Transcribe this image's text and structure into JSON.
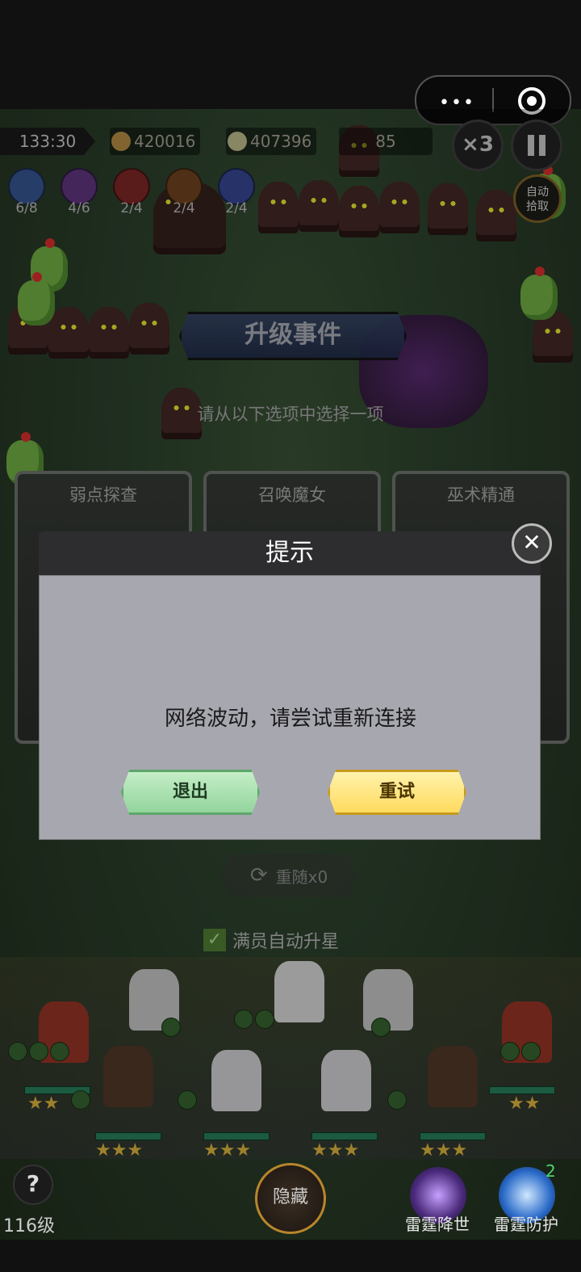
{
  "hud": {
    "timer": "133:30",
    "gold": "420016",
    "skulls": "407396",
    "kills": "85",
    "speed": "×3",
    "auto_pickup": "自动\n拾取"
  },
  "skills": [
    {
      "count": "6/8",
      "color": "#3b5ea0"
    },
    {
      "count": "4/6",
      "color": "#6a3b8a"
    },
    {
      "count": "2/4",
      "color": "#8a2a2a"
    },
    {
      "count": "2/4",
      "color": "#7a4a22"
    },
    {
      "count": "2/4",
      "color": "#3b4ea0"
    }
  ],
  "event": {
    "title": "升级事件",
    "subtitle": "请从以下选项中选择一项",
    "cards": [
      "弱点探查",
      "召唤魔女",
      "巫术精通"
    ]
  },
  "dialog": {
    "title": "提示",
    "message": "网络波动，请尝试重新连接",
    "exit_label": "退出",
    "retry_label": "重试",
    "close_glyph": "✕"
  },
  "refresh": {
    "label": "重随x0"
  },
  "auto_star": {
    "label": "满员自动升星"
  },
  "bottom": {
    "level": "116级",
    "hide": "隐藏",
    "ability1": "雷霆降世",
    "ability2": "雷霆防护",
    "ability2_count": "2",
    "help": "?"
  },
  "colors": {
    "exit_button": "#a8e0b0",
    "retry_button": "#ffe27a",
    "dialog_body": "#a7a7b0",
    "dialog_header": "#2d2d2f"
  }
}
